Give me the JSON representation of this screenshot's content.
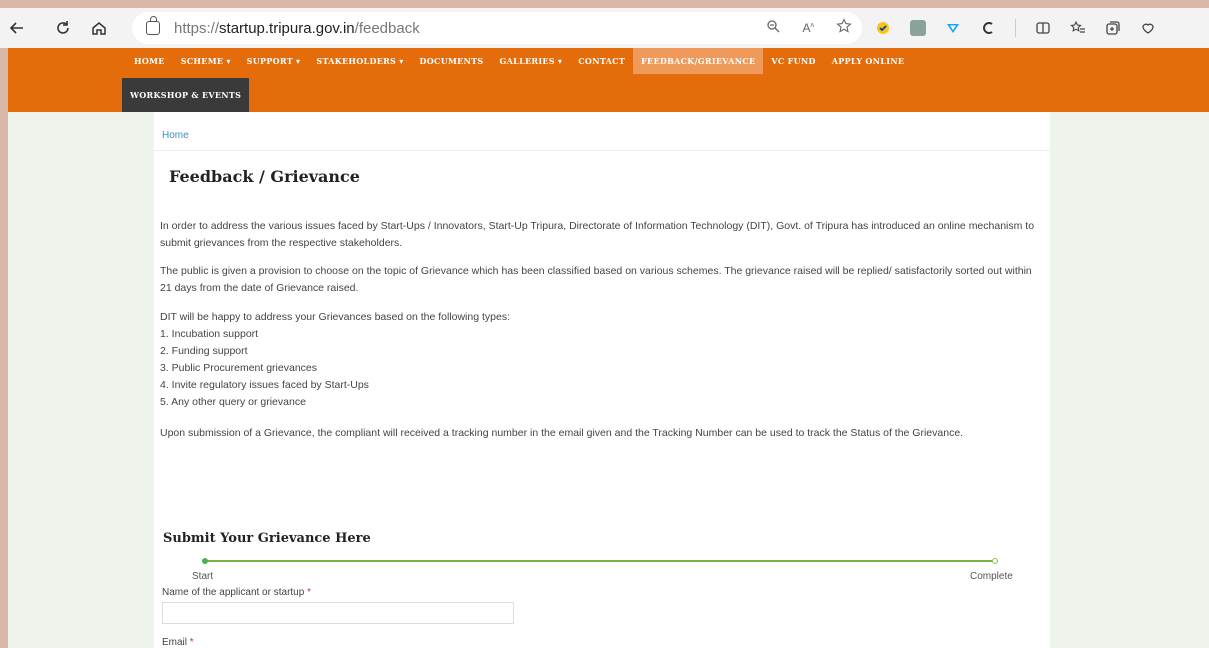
{
  "browser": {
    "url_scheme": "https://",
    "url_host": "startup.tripura.gov.in",
    "url_path": "/feedback",
    "nav_icons": [
      "back-icon",
      "refresh-icon",
      "home-icon"
    ],
    "address_icons": [
      "zoom-icon",
      "read-aloud-icon",
      "favorite-star-icon"
    ],
    "extension_icons": [
      "extension-1-icon",
      "extension-2-icon",
      "extension-3-icon",
      "extension-4-icon",
      "split-screen-icon",
      "favorites-icon",
      "collections-icon",
      "extensions-icon"
    ]
  },
  "menu": {
    "items": [
      {
        "label": "HOME"
      },
      {
        "label": "SCHEME ▾"
      },
      {
        "label": "SUPPORT ▾"
      },
      {
        "label": "STAKEHOLDERS ▾"
      },
      {
        "label": "DOCUMENTS"
      },
      {
        "label": "GALLERIES ▾"
      },
      {
        "label": "CONTACT"
      },
      {
        "label": "FEEDBACK/GRIEVANCE"
      },
      {
        "label": "VC FUND"
      },
      {
        "label": "APPLY ONLINE"
      }
    ],
    "second_row": "WORKSHOP & EVENTS"
  },
  "page": {
    "breadcrumb": "Home",
    "title": "Feedback / Grievance",
    "para1": "In order to address the various issues faced by Start-Ups / Innovators, Start-Up Tripura, Directorate of Information Technology (DIT), Govt. of Tripura has introduced an online mechanism to submit grievances from the respective stakeholders.",
    "para2": "The public is given a provision to choose on the topic of Grievance which has been classified based on various schemes. The grievance raised will be replied/ satisfactorily sorted out within 21 days from the date of Grievance raised.",
    "para3_intro": "DIT will be happy to address your Grievances based on the following types:",
    "types": [
      "1. Incubation support",
      "2. Funding support",
      "3. Public Procurement grievances",
      "4. Invite regulatory issues faced by Start-Ups",
      "5. Any other query or grievance"
    ],
    "para4": "Upon submission of a Grievance, the compliant will received a tracking number in the email given and the Tracking Number can be used to track the Status of the Grievance.",
    "form_title": "Submit Your Grievance Here",
    "progress_start": "Start",
    "progress_end": "Complete",
    "name_label": "Name of the applicant or startup",
    "email_label": "Email",
    "required_mark": "*"
  },
  "colors": {
    "header_orange": "#e46c0a",
    "active_menu": "#ef9a5a",
    "dark_button": "#3a3a3a",
    "progress_green": "#7cb342",
    "link_blue": "#3a8fc4"
  }
}
